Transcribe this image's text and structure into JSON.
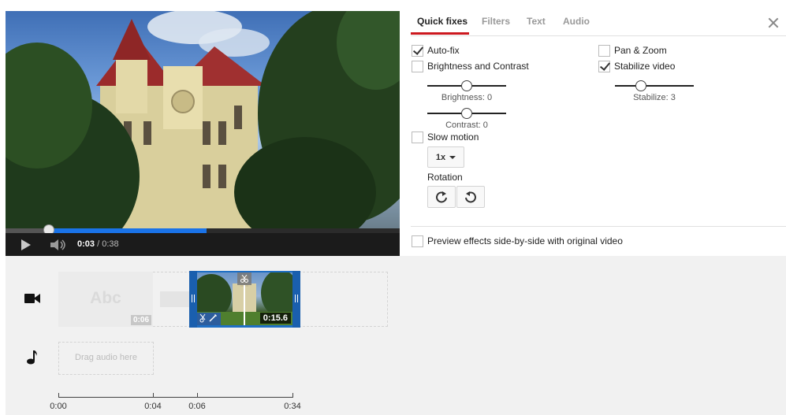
{
  "player": {
    "progress_fraction": 0.51,
    "buffer_fraction": 0.11,
    "time_current": "0:03",
    "time_separator": " / ",
    "time_total": "0:38"
  },
  "tabs": [
    {
      "label": "Quick fixes",
      "active": true
    },
    {
      "label": "Filters",
      "active": false
    },
    {
      "label": "Text",
      "active": false
    },
    {
      "label": "Audio",
      "active": false
    }
  ],
  "quick_fixes": {
    "auto_fix": {
      "label": "Auto-fix",
      "checked": true
    },
    "brightness_contrast": {
      "label": "Brightness and Contrast",
      "checked": false
    },
    "brightness_caption": "Brightness: 0",
    "brightness_value": 0.5,
    "contrast_caption": "Contrast: 0",
    "contrast_value": 0.5,
    "pan_zoom": {
      "label": "Pan & Zoom",
      "checked": false
    },
    "stabilize": {
      "label": "Stabilize video",
      "checked": true
    },
    "stabilize_caption": "Stabilize: 3",
    "stabilize_value": 0.33,
    "slow_motion": {
      "label": "Slow motion",
      "checked": false
    },
    "speed_value": "1x",
    "rotation_label": "Rotation",
    "preview_side_by_side": {
      "label": "Preview effects side-by-side with original video",
      "checked": false
    }
  },
  "timeline": {
    "title_clip_text": "Abc",
    "title_clip_duration": "0:06",
    "video_clip_duration": "0:15.6",
    "audio_placeholder": "Drag audio here",
    "ruler_ticks": [
      "0:00",
      "0:04",
      "0:06",
      "0:34"
    ]
  },
  "icons": {
    "video_track": "video-camera-icon",
    "audio_track": "music-note-icon",
    "rotate_right": "rotate-clockwise-icon",
    "rotate_left": "rotate-counterclockwise-icon"
  },
  "colors": {
    "accent_red": "#cc181e",
    "progress_blue": "#1a73e8",
    "clip_blue": "#1f6fc4"
  }
}
